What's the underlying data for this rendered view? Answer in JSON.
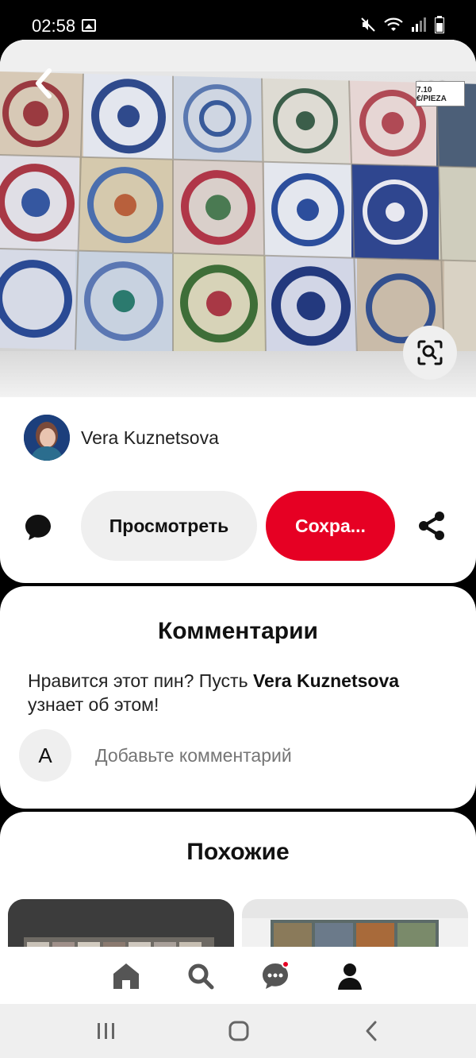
{
  "status_bar": {
    "time": "02:58"
  },
  "pin": {
    "price_tag": "7.10 €/PIEZA",
    "author_name": "Vera Kuznetsova",
    "view_label": "Просмотреть",
    "save_label": "Сохра..."
  },
  "comments": {
    "title": "Комментарии",
    "prompt_before": "Нравится этот пин? Пусть ",
    "prompt_name": "Vera Kuznetsova",
    "prompt_after": " узнает об этом!",
    "user_initial": "A",
    "input_placeholder": "Добавьте комментарий"
  },
  "similar": {
    "title": "Похожие"
  },
  "icons": {
    "back": "chevron-left-icon",
    "more": "more-dots-icon",
    "lens": "visual-search-icon",
    "comment": "speech-bubble-icon",
    "share": "share-icon",
    "home": "home-icon",
    "search": "search-icon",
    "messages": "messages-icon",
    "profile": "profile-icon"
  },
  "colors": {
    "brand_red": "#e60023",
    "button_gray": "#efefef"
  }
}
